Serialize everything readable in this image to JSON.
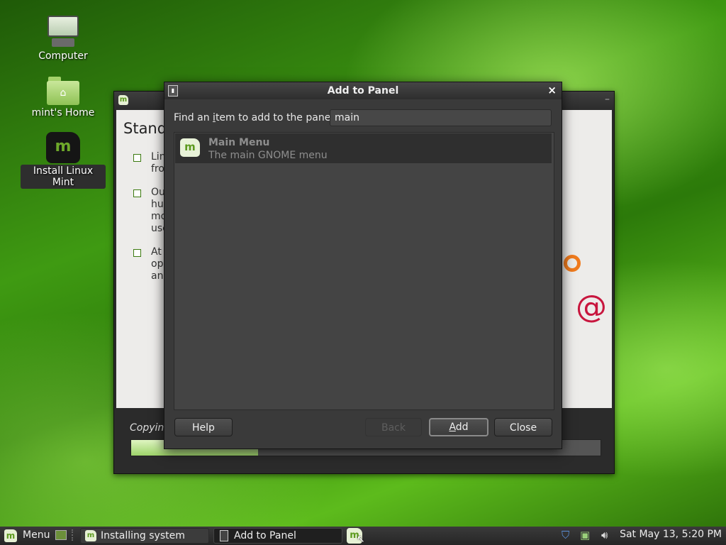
{
  "desktop": {
    "icons": [
      {
        "label": "Computer",
        "icon": "computer-icon"
      },
      {
        "label": "mint's Home",
        "icon": "home-folder-icon"
      },
      {
        "label": "Install Linux Mint",
        "icon": "linux-mint-logo-icon"
      }
    ]
  },
  "installer": {
    "heading": "Stand",
    "bullets": [
      {
        "text": "Lin\nfro"
      },
      {
        "text": "Ou\nhu\nmo\nuse"
      },
      {
        "text": "At\nop\nan"
      }
    ],
    "status": "Copying",
    "progress_percent": 27
  },
  "dialog": {
    "title": "Add to Panel",
    "find_label_pre": "Find an ",
    "find_label_mnemonic": "i",
    "find_label_post": "tem to add to the panel:",
    "search_value": "main",
    "items": [
      {
        "name": "Main Menu",
        "description": "The main GNOME menu",
        "icon": "linux-mint-menu-icon"
      }
    ],
    "buttons": {
      "help": "Help",
      "back": "Back",
      "add_mnemonic": "A",
      "add_rest": "dd",
      "close": "Close"
    }
  },
  "taskbar": {
    "menu_label": "Menu",
    "tasks": [
      {
        "label": "Installing system"
      },
      {
        "label": "Add to Panel"
      }
    ],
    "clock": "Sat May 13,  5:20 PM"
  }
}
